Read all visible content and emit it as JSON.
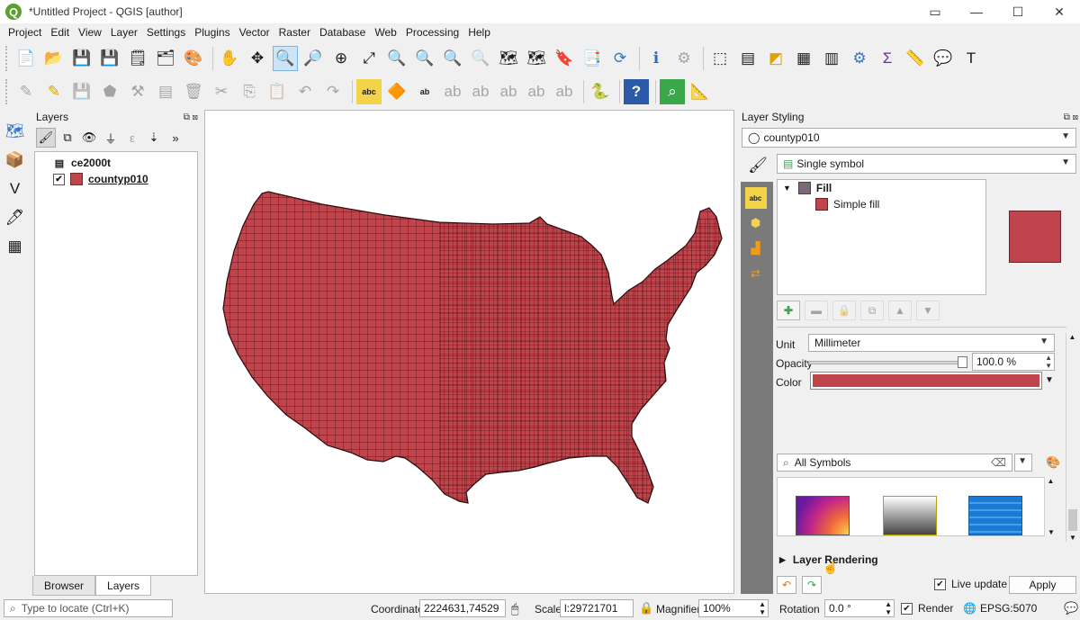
{
  "window": {
    "title": "*Untitled Project - QGIS [author]",
    "buttons": [
      "▭",
      "—",
      "☐",
      "✕"
    ]
  },
  "menu": [
    "Project",
    "Edit",
    "View",
    "Layer",
    "Settings",
    "Plugins",
    "Vector",
    "Raster",
    "Database",
    "Web",
    "Processing",
    "Help"
  ],
  "layers_panel": {
    "title": "Layers",
    "layers": [
      {
        "name": "ce2000t",
        "type": "table",
        "checked": null
      },
      {
        "name": "countyp010",
        "type": "polygon",
        "checked": true,
        "color": "#c0444c"
      }
    ],
    "tabs": [
      "Browser",
      "Layers"
    ],
    "active_tab": "Layers"
  },
  "styling_panel": {
    "title": "Layer Styling",
    "layer_combo": "countyp010",
    "renderer": "Single symbol",
    "symbol_tree": [
      {
        "label": "Fill",
        "level": 0
      },
      {
        "label": "Simple fill",
        "level": 1
      }
    ],
    "unit_label": "Unit",
    "unit_value": "Millimeter",
    "opacity_label": "Opacity",
    "opacity_value": "100.0 %",
    "opacity_fraction": 1.0,
    "color_label": "Color",
    "fill_color": "#c0444c",
    "search_text": "All Symbols",
    "layer_rendering": "Layer Rendering",
    "live_update": "Live update",
    "apply": "Apply"
  },
  "statusbar": {
    "locator_placeholder": "Type to locate (Ctrl+K)",
    "coordinate_label": "Coordinate",
    "coordinate_value": "2224631,74529",
    "scale_label": "Scale",
    "scale_value": "l:29721701",
    "magnifier_label": "Magnifier",
    "magnifier_value": "100%",
    "rotation_label": "Rotation",
    "rotation_value": "0.0 °",
    "render_label": "Render",
    "crs": "EPSG:5070"
  }
}
